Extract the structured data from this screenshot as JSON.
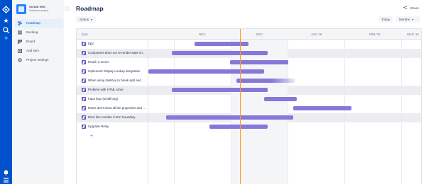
{
  "project": {
    "name": "scrum test",
    "type": "Software project"
  },
  "sidebar": {
    "items": [
      {
        "label": "Roadmap",
        "icon": "roadmap-icon",
        "active": true
      },
      {
        "label": "Backlog",
        "icon": "backlog-icon",
        "active": false
      },
      {
        "label": "Board",
        "icon": "board-icon",
        "active": false
      },
      {
        "label": "Add item",
        "icon": "add-item-icon",
        "active": false
      },
      {
        "label": "Project settings",
        "icon": "settings-icon",
        "active": false
      }
    ]
  },
  "header": {
    "title": "Roadmap",
    "share_label": "Share",
    "status_label": "Status",
    "today_label": "Today",
    "months_label": "Months"
  },
  "roadmap": {
    "epic_column": "Epic",
    "months": [
      "NOV",
      "DEC",
      "JAN '19",
      "FEB '19",
      "MAR '19"
    ],
    "epics": [
      {
        "label": "Epic",
        "start": 0.168,
        "end": 0.368,
        "highlight": false,
        "fade": false
      },
      {
        "label": "Component does not re-render state change",
        "start": 0.085,
        "end": 0.438,
        "highlight": true,
        "fade": false
      },
      {
        "label": "Reach a meme",
        "start": 0.3,
        "end": 0.512,
        "highlight": false,
        "fade": false
      },
      {
        "label": "Implement Display Lookup integration",
        "start": 0.0,
        "end": 0.424,
        "highlight": false,
        "fade": false
      },
      {
        "label": "When using !lastKey to break split and make it work",
        "start": 0.322,
        "end": 0.538,
        "highlight": false,
        "fade": true
      },
      {
        "label": "Problem with HTML sizes",
        "start": 0.085,
        "end": 0.438,
        "highlight": true,
        "fade": false
      },
      {
        "label": "Input logo (small bug)",
        "start": 0.424,
        "end": 0.544,
        "highlight": false,
        "fade": false
      },
      {
        "label": "Rams don't show all the properties and some render",
        "start": 0.53,
        "end": 0.745,
        "highlight": false,
        "fade": false
      },
      {
        "label": "Error line number in Errr boundary",
        "start": 0.064,
        "end": 0.53,
        "highlight": true,
        "fade": false
      },
      {
        "label": "Upgrade Relay",
        "start": 0.224,
        "end": 0.438,
        "highlight": false,
        "fade": false
      }
    ],
    "today_position": 0.336
  },
  "icons": {
    "rail": [
      "jira-logo-icon",
      "star-icon",
      "search-icon",
      "create-icon",
      "notifications-icon",
      "menu-icon"
    ],
    "share": "share-icon",
    "chevron": "chevron-down-icon"
  },
  "colors": {
    "rail": "#0052cc",
    "epic": "#6554c0",
    "bar": "#8777d9",
    "today_line": "#ff991f",
    "sidebar_bg": "#f4f5f7"
  }
}
